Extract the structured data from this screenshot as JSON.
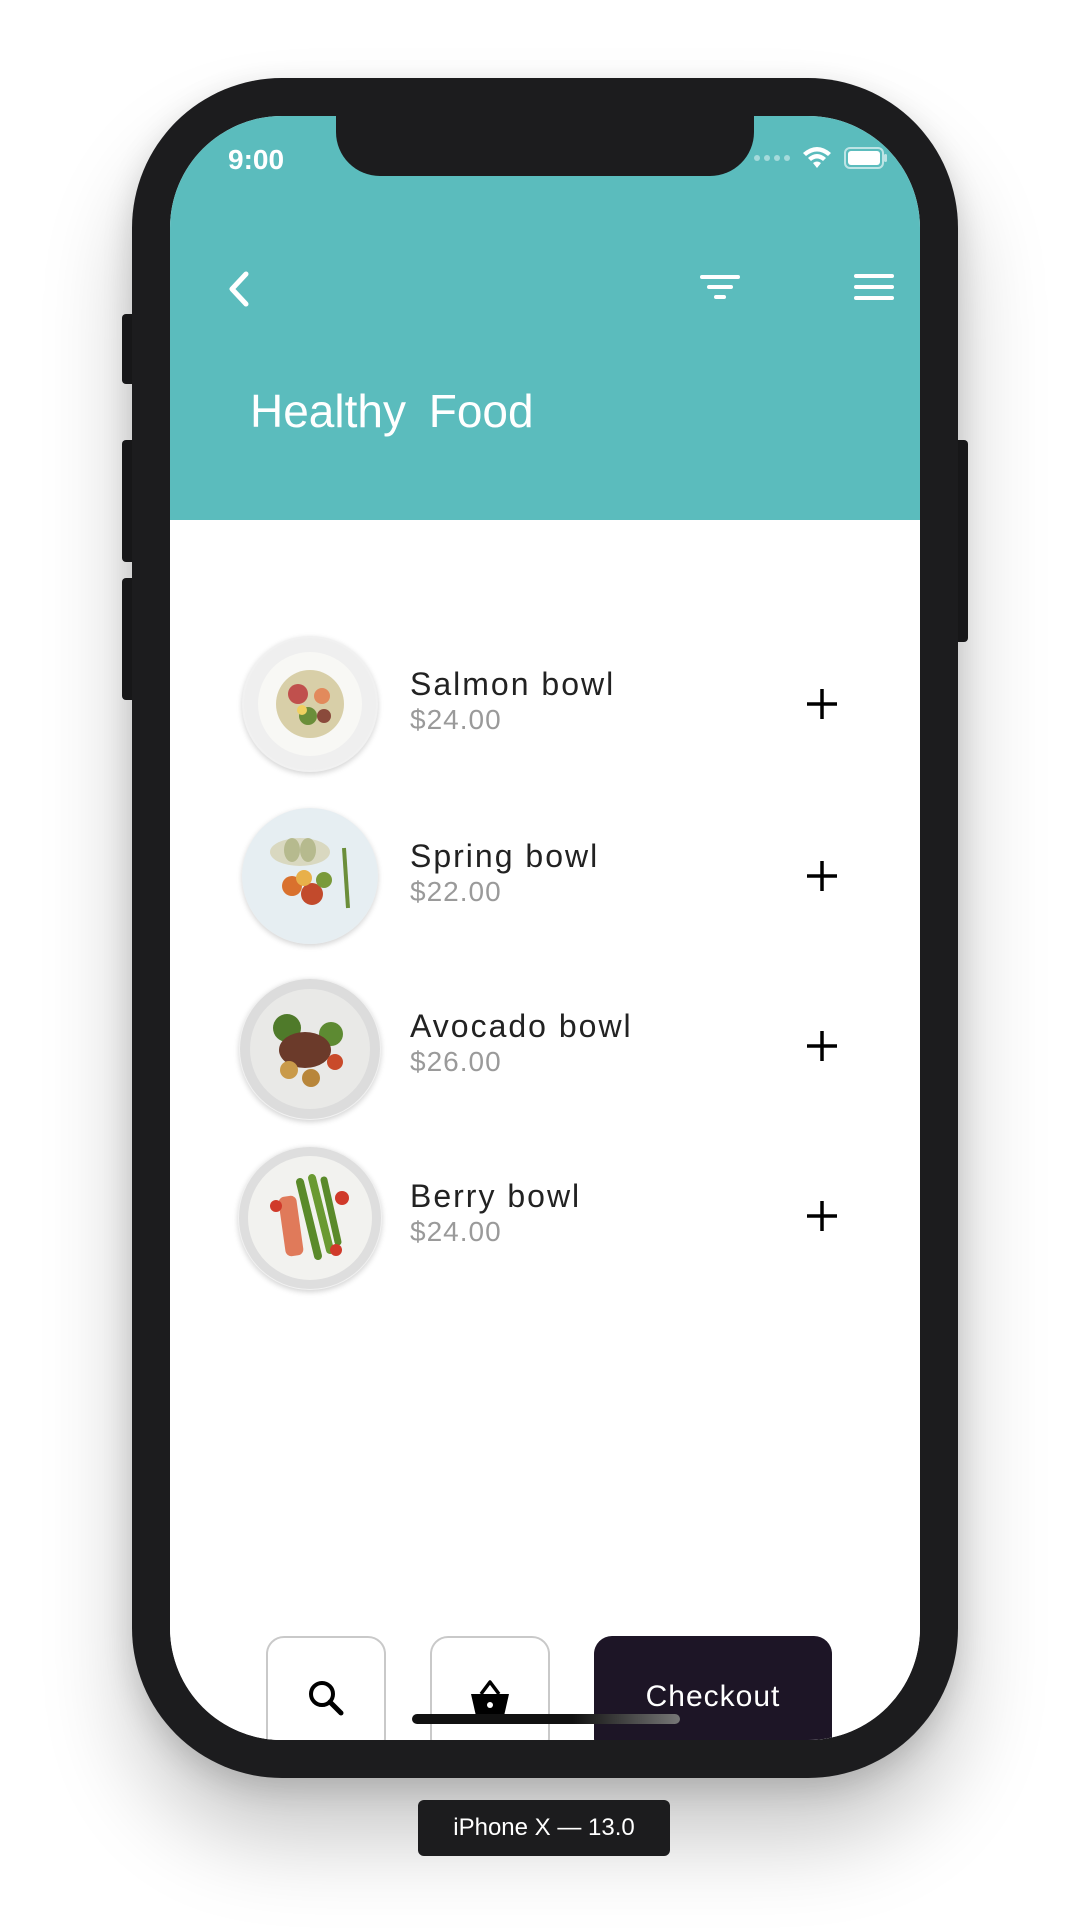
{
  "status_bar": {
    "time": "9:00"
  },
  "header": {
    "title": "Healthy  Food",
    "background_color": "#5bbcbd",
    "back_icon": "chevron-left-icon",
    "filter_icon": "filter-icon",
    "menu_icon": "hamburger-menu-icon"
  },
  "items": [
    {
      "name": "Salmon bowl",
      "price": "$24.00"
    },
    {
      "name": "Spring bowl",
      "price": "$22.00"
    },
    {
      "name": "Avocado bowl",
      "price": "$26.00"
    },
    {
      "name": "Berry bowl",
      "price": "$24.00"
    }
  ],
  "bottom_bar": {
    "search_icon": "search-icon",
    "basket_icon": "basket-icon",
    "checkout_label": "Checkout",
    "checkout_color": "#1d1526"
  },
  "device_label": "iPhone X — 13.0"
}
